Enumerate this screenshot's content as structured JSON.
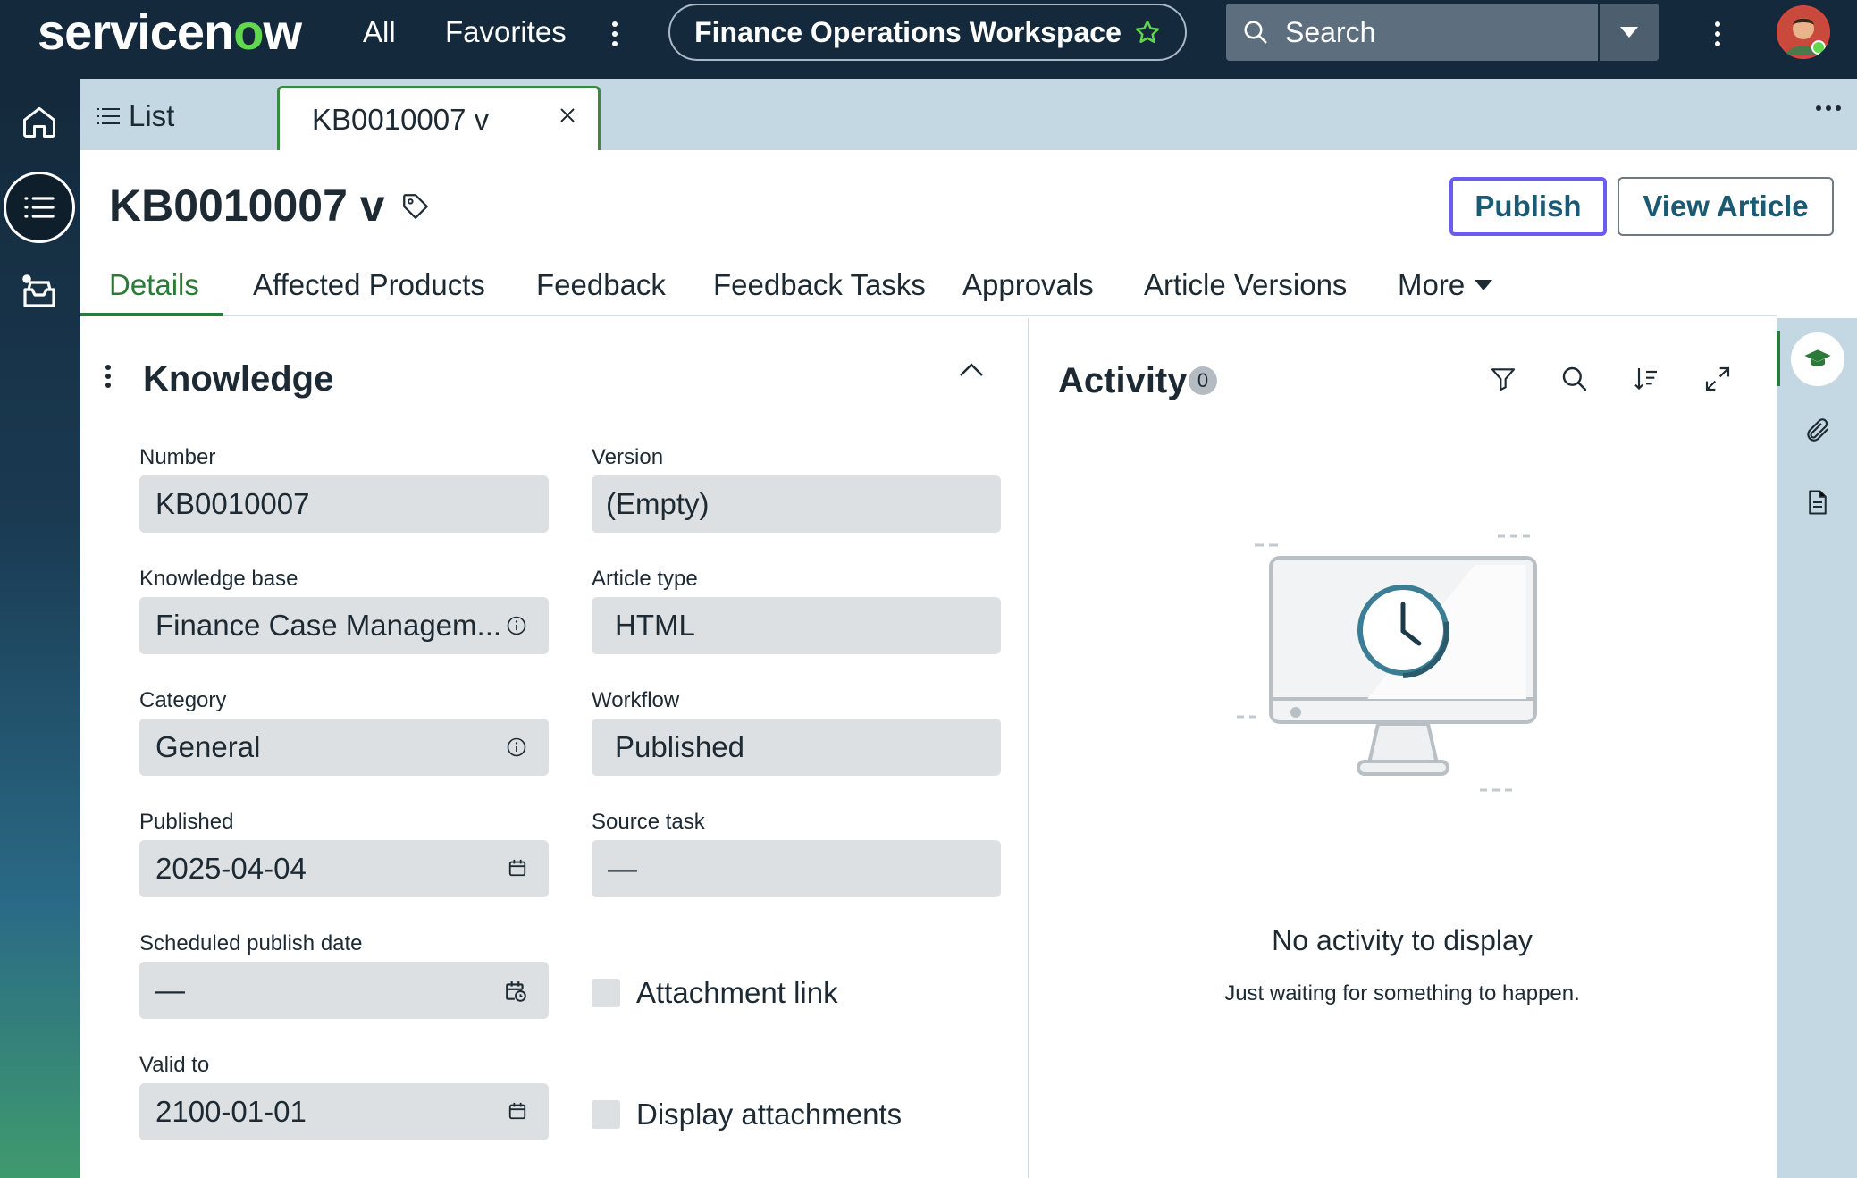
{
  "topnav": {
    "logo_pre": "servicen",
    "logo_o": "o",
    "logo_post": "w",
    "all_label": "All",
    "favorites_label": "Favorites",
    "workspace_title": "Finance Operations Workspace",
    "search_placeholder": "Search"
  },
  "tabstrip": {
    "list_label": "List",
    "record_tab_label": "KB0010007 v"
  },
  "header": {
    "title": "KB0010007 v",
    "publish_label": "Publish",
    "view_article_label": "View Article"
  },
  "tabs": [
    {
      "label": "Details",
      "active": true
    },
    {
      "label": "Affected Products"
    },
    {
      "label": "Feedback"
    },
    {
      "label": "Feedback Tasks"
    },
    {
      "label": "Approvals"
    },
    {
      "label": "Article Versions"
    },
    {
      "label": "More"
    }
  ],
  "knowledge": {
    "section_title": "Knowledge",
    "number_label": "Number",
    "number_value": "KB0010007",
    "version_label": "Version",
    "version_value": "(Empty)",
    "kb_label": "Knowledge base",
    "kb_value": "Finance Case Managem...",
    "article_type_label": "Article type",
    "article_type_value": "HTML",
    "category_label": "Category",
    "category_value": "General",
    "workflow_label": "Workflow",
    "workflow_value": "Published",
    "published_label": "Published",
    "published_value": "2025-04-04",
    "source_task_label": "Source task",
    "source_task_value": "—",
    "scheduled_label": "Scheduled publish date",
    "scheduled_value": "—",
    "attachment_link_label": "Attachment link",
    "valid_to_label": "Valid to",
    "valid_to_value": "2100-01-01",
    "display_attachments_label": "Display attachments"
  },
  "activity": {
    "title": "Activity",
    "count": "0",
    "empty_title": "No activity to display",
    "empty_subtitle": "Just waiting for something to happen."
  },
  "colors": {
    "nav_bg": "#14293b",
    "accent_green": "#2b7a3a",
    "publish_border": "#6b5cf0",
    "tabstrip_bg": "#c3d8e2"
  }
}
